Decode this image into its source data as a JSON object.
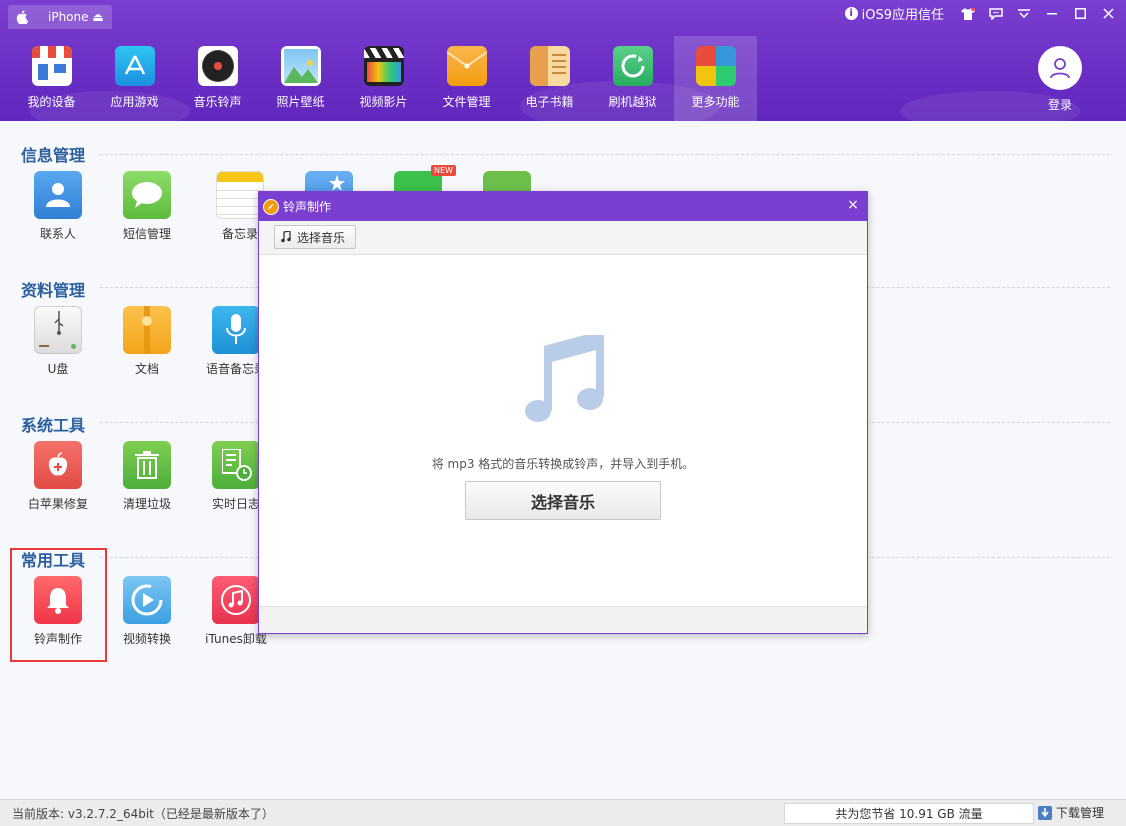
{
  "header": {
    "device": "iPhone ⏏",
    "trust": "iOS9应用信任",
    "nav": [
      {
        "label": "我的设备",
        "icon": "store-icon"
      },
      {
        "label": "应用游戏",
        "icon": "app-store-icon"
      },
      {
        "label": "音乐铃声",
        "icon": "vinyl-icon"
      },
      {
        "label": "照片壁纸",
        "icon": "photo-icon"
      },
      {
        "label": "视频影片",
        "icon": "clapper-icon"
      },
      {
        "label": "文件管理",
        "icon": "folder-icon"
      },
      {
        "label": "电子书籍",
        "icon": "book-icon"
      },
      {
        "label": "刷机越狱",
        "icon": "refresh-icon"
      },
      {
        "label": "更多功能",
        "icon": "grid-icon"
      }
    ],
    "login": "登录"
  },
  "sections": {
    "info": {
      "title": "信息管理",
      "items": [
        "联系人",
        "短信管理",
        "备忘录"
      ]
    },
    "data": {
      "title": "资料管理",
      "items": [
        "U盘",
        "文档",
        "语音备忘录"
      ]
    },
    "system": {
      "title": "系统工具",
      "items": [
        "白苹果修复",
        "清理垃圾",
        "实时日志"
      ]
    },
    "common": {
      "title": "常用工具",
      "items": [
        "铃声制作",
        "视频转换",
        "iTunes卸载"
      ]
    }
  },
  "badge_new": "NEW",
  "dialog": {
    "title": "铃声制作",
    "toolbar_button": "选择音乐",
    "hint": "将 mp3 格式的音乐转换成铃声，并导入到手机。",
    "main_button": "选择音乐",
    "close": "×"
  },
  "status": {
    "version": "当前版本: v3.2.7.2_64bit（已经是最新版本了）",
    "saved": "共为您节省  10.91 GB 流量",
    "download": "下载管理"
  }
}
